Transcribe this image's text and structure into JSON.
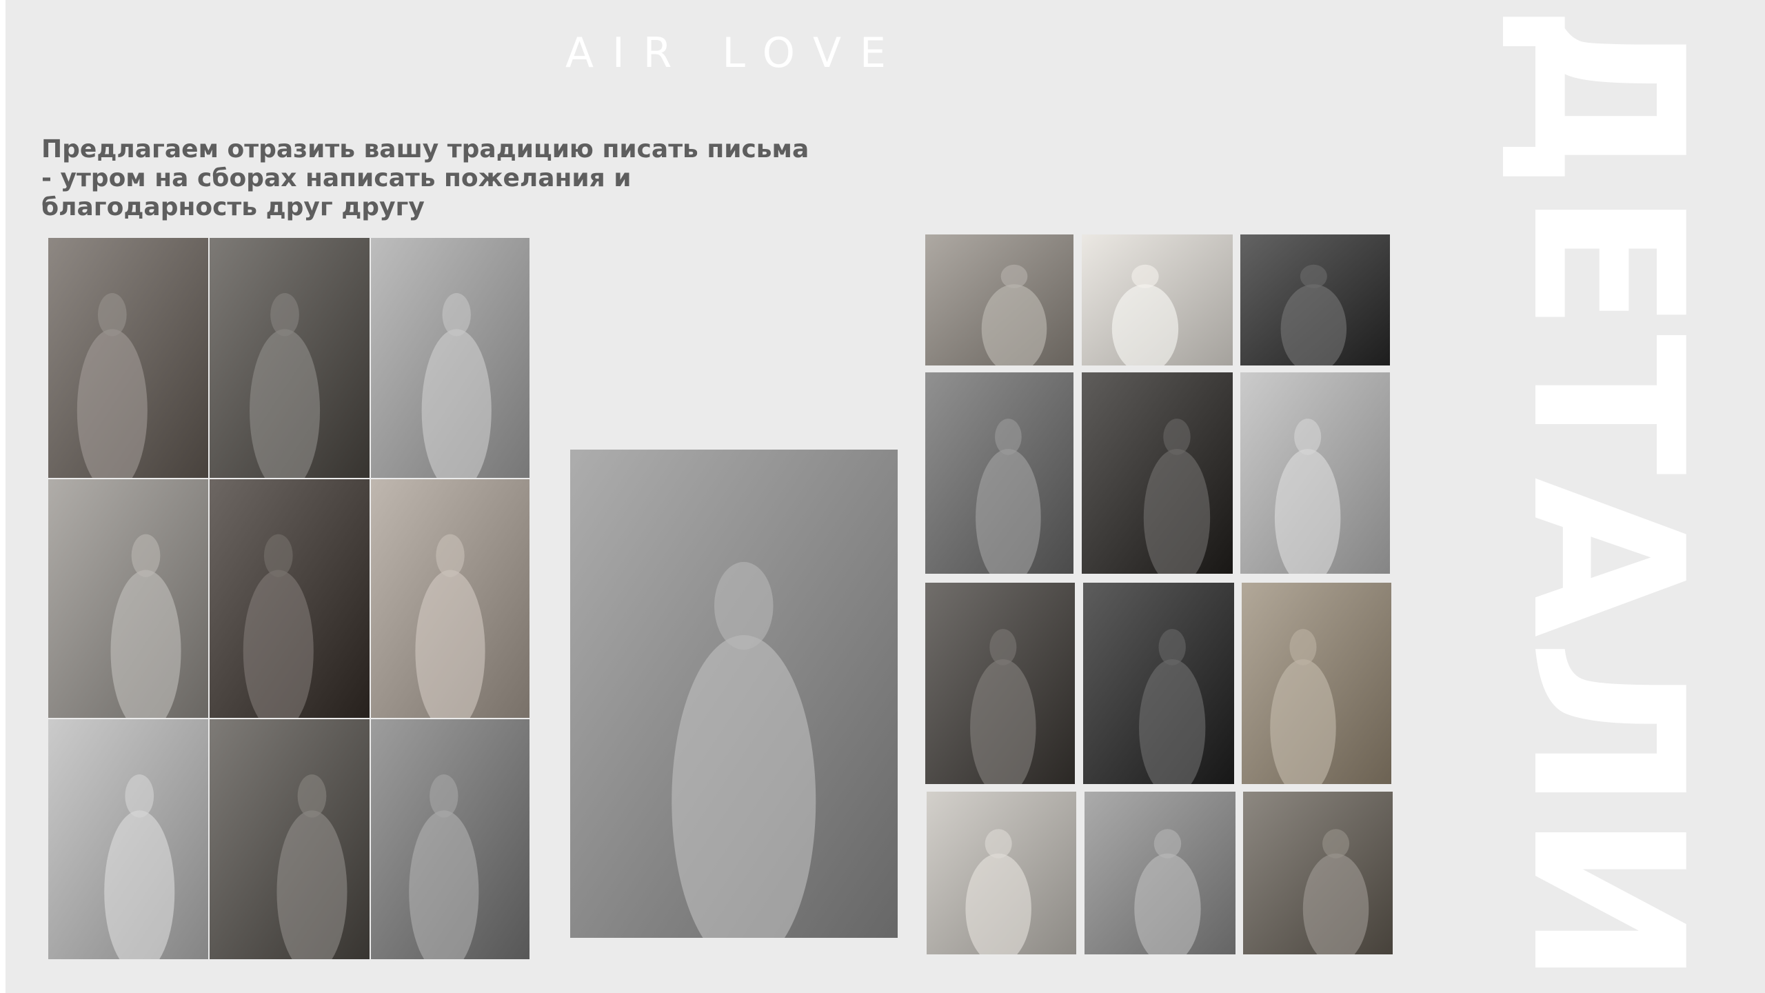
{
  "brand": "AIR LOVE",
  "intro": {
    "lines": [
      "Предлагаем отразить вашу традицию писать письма",
      "- утром на сборах написать пожелания и",
      "благодарность друг другу"
    ]
  },
  "side_title": "ДЕТАЛИ",
  "colors": {
    "background": "#ebebeb",
    "heading_text": "#5e5e5e",
    "brand_text": "#ffffff",
    "side_title": "#ffffff"
  },
  "photos": [
    {
      "name": "photo-groom-reading-letter",
      "tone": "#6b6560"
    },
    {
      "name": "photo-rings-and-note",
      "tone": "#5a5753"
    },
    {
      "name": "photo-couple-embracing-window",
      "tone": "#9a9a9a"
    },
    {
      "name": "photo-couple-kissing-bed",
      "tone": "#8d8a86"
    },
    {
      "name": "photo-couple-kiss-doorway",
      "tone": "#4a4440"
    },
    {
      "name": "photo-bride-reading-letter",
      "tone": "#9c948c"
    },
    {
      "name": "photo-bride-portrait-bw",
      "tone": "#a8a8a8"
    },
    {
      "name": "photo-champagne-glasses",
      "tone": "#5b5854"
    },
    {
      "name": "photo-couple-hugging-bw",
      "tone": "#7a7a7a"
    },
    {
      "name": "photo-groom-and-bride-doorway",
      "tone": "#8a8a8a"
    },
    {
      "name": "photo-white-bouquet",
      "tone": "#8b8680"
    },
    {
      "name": "photo-satin-fabric",
      "tone": "#c8c5c0"
    },
    {
      "name": "photo-bride-in-room",
      "tone": "#404040"
    },
    {
      "name": "photo-bride-seated-bw",
      "tone": "#6e6e6e"
    },
    {
      "name": "photo-jewelry-details",
      "tone": "#3c3a38"
    },
    {
      "name": "photo-corset-dress",
      "tone": "#a8a8a8"
    },
    {
      "name": "photo-bride-hair-bun",
      "tone": "#4e4b48"
    },
    {
      "name": "photo-bride-veil-bw",
      "tone": "#3a3a3a"
    },
    {
      "name": "photo-bride-lamp-bouquet",
      "tone": "#8f8576"
    },
    {
      "name": "photo-flowers-accessories",
      "tone": "#b0ada8"
    },
    {
      "name": "photo-corset-closeup-bw",
      "tone": "#888888"
    },
    {
      "name": "photo-bride-standing-bouquet",
      "tone": "#6a655e"
    }
  ]
}
